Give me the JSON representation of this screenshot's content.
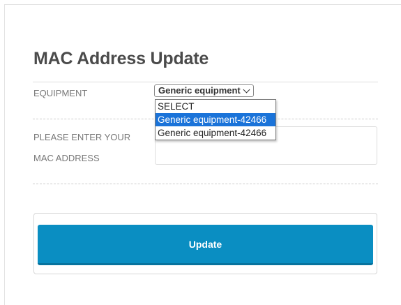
{
  "form": {
    "title": "MAC Address Update",
    "equipment_label": "EQUIPMENT",
    "equipment_selected": "Generic equipment",
    "mac_label_line1": "PLEASE ENTER YOUR",
    "mac_label_line2": "MAC ADDRESS",
    "mac_value": "",
    "update_label": "Update"
  },
  "dropdown": {
    "options": [
      {
        "label": "SELECT",
        "selected": false
      },
      {
        "label": "Generic equipment-42466",
        "selected": true
      },
      {
        "label": "Generic equipment-42466",
        "selected": false
      }
    ]
  },
  "colors": {
    "accent": "#0a8ec2",
    "highlight": "#1a73d9"
  }
}
